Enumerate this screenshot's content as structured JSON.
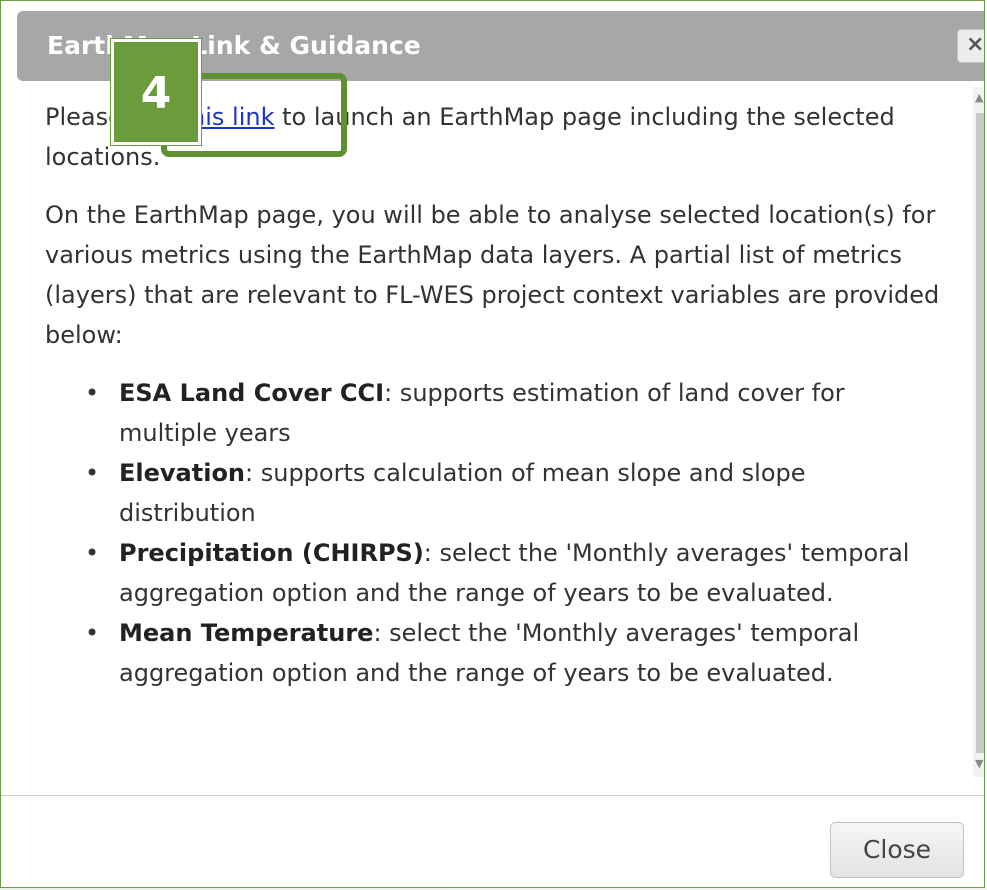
{
  "dialog": {
    "title": "EarthMap Link & Guidance",
    "close_icon": "×",
    "intro_before_link": "Please use ",
    "link_text": "this link",
    "intro_after_link": " to launch an EarthMap page including the selected locations.",
    "paragraph2": "On the EarthMap page, you will be able to analyse selected location(s) for various metrics using the EarthMap data layers. A partial list of metrics (layers) that are relevant to FL-WES project context variables are provided below:",
    "bullet_char": "•",
    "metrics": [
      {
        "name": "ESA Land Cover CCI",
        "description": ": supports estimation of land cover for multiple years"
      },
      {
        "name": "Elevation",
        "description": ": supports calculation of mean slope and slope distribution"
      },
      {
        "name": "Precipitation (CHIRPS)",
        "description": ": select the 'Monthly averages' temporal aggregation option and the range of years to be evaluated."
      },
      {
        "name": "Mean Temperature",
        "description": ": select the 'Monthly averages' temporal aggregation option and the range of years to be evaluated."
      }
    ],
    "close_button_label": "Close"
  },
  "annotation": {
    "step_number": "4",
    "accent_color": "#6b9c3c"
  },
  "icons": {
    "close": "close-icon",
    "scroll_up": "chevron-up-icon",
    "scroll_down": "chevron-down-icon"
  },
  "scroll_glyphs": {
    "up": "▲",
    "down": "▼"
  }
}
